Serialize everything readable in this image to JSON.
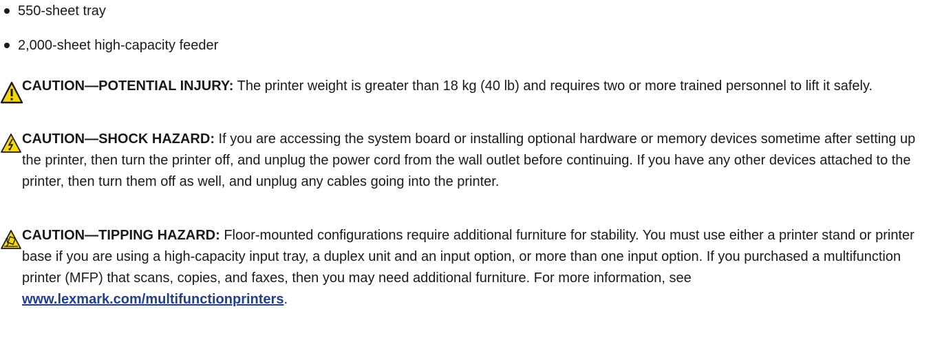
{
  "bullets": [
    "550-sheet tray",
    "2,000-sheet high-capacity feeder"
  ],
  "cautions": [
    {
      "icon": "potential-injury-warning-icon",
      "label": "CAUTION—POTENTIAL INJURY:",
      "text": " The printer weight is greater than 18 kg (40 lb) and requires two or more trained personnel to lift it safely."
    },
    {
      "icon": "shock-hazard-icon",
      "label": "CAUTION—SHOCK HAZARD:",
      "text": " If you are accessing the system board or installing optional hardware or memory devices sometime after setting up the printer, then turn the printer off, and unplug the power cord from the wall outlet before continuing. If you have any other devices attached to the printer, then turn them off as well, and unplug any cables going into the printer."
    },
    {
      "icon": "tipping-hazard-icon",
      "label": "CAUTION—TIPPING HAZARD:",
      "text": " Floor-mounted configurations require additional furniture for stability. You must use either a printer stand or printer base if you are using a high-capacity input tray, a duplex unit and an input option, or more than one input option. If you purchased a multifunction printer (MFP) that scans, copies, and faxes, then you may need additional furniture. For more information, see ",
      "link": "www.lexmark.com/multifunctionprinters",
      "tail": "."
    }
  ],
  "colors": {
    "warning_yellow": "#f5d800",
    "link_blue": "#1f3f8f",
    "text": "#1a1a1a"
  }
}
